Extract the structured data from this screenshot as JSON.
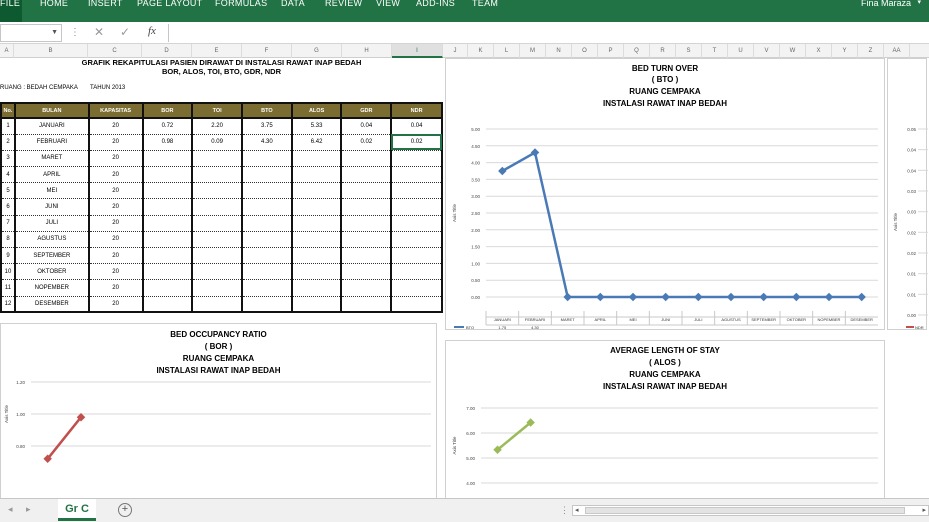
{
  "ribbon": {
    "tabs": [
      "FILE",
      "HOME",
      "INSERT",
      "PAGE LAYOUT",
      "FORMULAS",
      "DATA",
      "REVIEW",
      "VIEW",
      "ADD-INS",
      "TEAM"
    ],
    "user": "Fina Maraza"
  },
  "formula_bar": {
    "name_box": "",
    "fx_label": "fx",
    "value": ""
  },
  "columns": [
    "A",
    "B",
    "C",
    "D",
    "E",
    "F",
    "G",
    "H",
    "I",
    "J",
    "K",
    "L",
    "M",
    "N",
    "O",
    "P",
    "Q",
    "R",
    "S",
    "T",
    "U",
    "V",
    "W",
    "X",
    "Y",
    "Z",
    "AA"
  ],
  "sheet": {
    "title_line1": "GRAFIK REKAPITULASI PASIEN DIRAWAT DI INSTALASI RAWAT INAP BEDAH",
    "title_line2": "BOR, ALOS, TOI, BTO, GDR, NDR",
    "ruang": "RUANG : BEDAH CEMPAKA",
    "tahun": "TAHUN 2013",
    "table": {
      "headers": [
        "No.",
        "BULAN",
        "KAPASITAS",
        "BOR",
        "TOI",
        "BTO",
        "ALOS",
        "GDR",
        "NDR"
      ],
      "rows": [
        [
          "1",
          "JANUARI",
          "20",
          "0.72",
          "2.20",
          "3.75",
          "5.33",
          "0.04",
          "0.04"
        ],
        [
          "2",
          "FEBRUARI",
          "20",
          "0.98",
          "0.09",
          "4.30",
          "6.42",
          "0.02",
          "0.02"
        ],
        [
          "3",
          "MARET",
          "20",
          "",
          "",
          "",
          "",
          "",
          ""
        ],
        [
          "4",
          "APRIL",
          "20",
          "",
          "",
          "",
          "",
          "",
          ""
        ],
        [
          "5",
          "MEI",
          "20",
          "",
          "",
          "",
          "",
          "",
          ""
        ],
        [
          "6",
          "JUNI",
          "20",
          "",
          "",
          "",
          "",
          "",
          ""
        ],
        [
          "7",
          "JULI",
          "20",
          "",
          "",
          "",
          "",
          "",
          ""
        ],
        [
          "8",
          "AGUSTUS",
          "20",
          "",
          "",
          "",
          "",
          "",
          ""
        ],
        [
          "9",
          "SEPTEMBER",
          "20",
          "",
          "",
          "",
          "",
          "",
          ""
        ],
        [
          "10",
          "OKTOBER",
          "20",
          "",
          "",
          "",
          "",
          "",
          ""
        ],
        [
          "11",
          "NOPEMBER",
          "20",
          "",
          "",
          "",
          "",
          "",
          ""
        ],
        [
          "12",
          "DESEMBER",
          "20",
          "",
          "",
          "",
          "",
          "",
          ""
        ]
      ]
    }
  },
  "charts": {
    "bto": {
      "title": [
        "BED TURN OVER",
        "( BTO )",
        "RUANG CEMPAKA",
        "INSTALASI RAWAT INAP BEDAH"
      ],
      "axis_title": "Axis Title",
      "legend": "BTO",
      "color": "#4a7ab5"
    },
    "bor": {
      "title": [
        "BED OCCUPANCY RATIO",
        "( BOR )",
        "RUANG CEMPAKA",
        "INSTALASI RAWAT INAP BEDAH"
      ],
      "axis_title": "Axis Title",
      "color": "#c0504d"
    },
    "alos": {
      "title": [
        "AVERAGE LENGTH OF STAY",
        "( ALOS )",
        "RUANG CEMPAKA",
        "INSTALASI RAWAT INAP BEDAH"
      ],
      "axis_title": "Axis Title",
      "color": "#9bbb59"
    },
    "ndr": {
      "axis_title": "Axis Title",
      "legend": "NDR",
      "color": "#c0504d"
    }
  },
  "chart_data": [
    {
      "type": "line",
      "title": "BED TURN OVER ( BTO ) RUANG CEMPAKA INSTALASI RAWAT INAP BEDAH",
      "categories": [
        "JANUARI",
        "FEBRUARI",
        "MARET",
        "APRIL",
        "MEI",
        "JUNI",
        "JULI",
        "AGUSTUS",
        "SEPTEMBER",
        "OKTOBER",
        "NOPEMBER",
        "DESEMBER"
      ],
      "series": [
        {
          "name": "BTO",
          "values": [
            3.75,
            4.3,
            0,
            0,
            0,
            0,
            0,
            0,
            0,
            0,
            0,
            0
          ]
        }
      ],
      "ylabel": "Axis Title",
      "ylim": [
        0,
        5
      ],
      "yticks": [
        "0.00",
        "0.50",
        "1.00",
        "1.50",
        "2.00",
        "2.50",
        "3.00",
        "3.50",
        "4.00",
        "4.50",
        "5.00"
      ],
      "data_table": [
        "1.75",
        "4.30"
      ],
      "grid": true,
      "legend": "data-table"
    },
    {
      "type": "line",
      "title": "BED OCCUPANCY RATIO ( BOR ) RUANG CEMPAKA INSTALASI RAWAT INAP BEDAH",
      "series": [
        {
          "values": [
            0.72,
            0.98
          ]
        }
      ],
      "ylabel": "Axis Title",
      "yticks": [
        "0.80",
        "1.00",
        "1.20"
      ],
      "grid": true
    },
    {
      "type": "line",
      "title": "AVERAGE LENGTH OF STAY ( ALOS ) RUANG CEMPAKA INSTALASI RAWAT INAP BEDAH",
      "series": [
        {
          "values": [
            5.33,
            6.42
          ]
        }
      ],
      "ylabel": "Axis Title",
      "yticks": [
        "4.00",
        "5.00",
        "6.00",
        "7.00"
      ],
      "grid": true
    },
    {
      "type": "line",
      "series": [
        {
          "name": "NDR",
          "values": []
        }
      ],
      "ylabel": "Axis Title",
      "yticks": [
        "0.00",
        "0.01",
        "0.01",
        "0.02",
        "0.02",
        "0.03",
        "0.03",
        "0.04",
        "0.04",
        "0.05"
      ],
      "grid": true
    }
  ],
  "bottom": {
    "sheet_tab": "Gr C"
  }
}
